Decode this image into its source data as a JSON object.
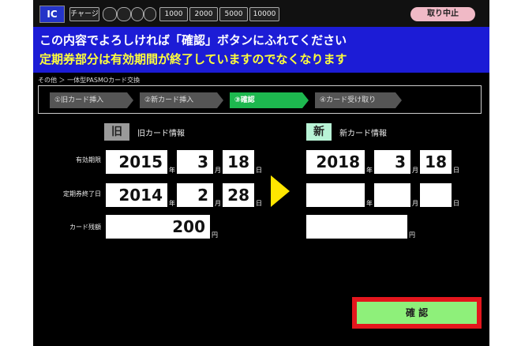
{
  "top_bar": {
    "ic_label": "IC",
    "chips": [
      "チャージ",
      "",
      "",
      "",
      "1000",
      "2000",
      "5000",
      "10000"
    ],
    "cancel_label": "取り中止"
  },
  "instruction": {
    "line1": "この内容でよろしければ「確認」ボタンにふれてください",
    "line2": "定期券部分は有効期間が終了していますのでなくなります"
  },
  "breadcrumb": "その他 ＞ 一体型PASMOカード交換",
  "steps": [
    "①旧カード挿入",
    "②新カード挿入",
    "③確認",
    "④カード受け取り"
  ],
  "old_card": {
    "tag": "旧",
    "caption": "旧カード情報",
    "expiry": {
      "year": "2015",
      "month": "3",
      "day": "18"
    },
    "pass_end": {
      "year": "2014",
      "month": "2",
      "day": "28"
    },
    "balance": "200"
  },
  "new_card": {
    "tag": "新",
    "caption": "新カード情報",
    "expiry": {
      "year": "2018",
      "month": "3",
      "day": "18"
    },
    "pass_end": {
      "year": "",
      "month": "",
      "day": ""
    },
    "balance": ""
  },
  "row_labels": {
    "expiry": "有効期限",
    "pass_end": "定期券終了日",
    "balance": "カード残額"
  },
  "units": {
    "year": "年",
    "month": "月",
    "day": "日",
    "yen": "円"
  },
  "confirm_label": "確 認",
  "colors": {
    "banner": "#1c1cd6",
    "active_step": "#1db84f",
    "confirm": "#8ef07a",
    "highlight": "#e4161d",
    "arrow": "#ffe600"
  }
}
